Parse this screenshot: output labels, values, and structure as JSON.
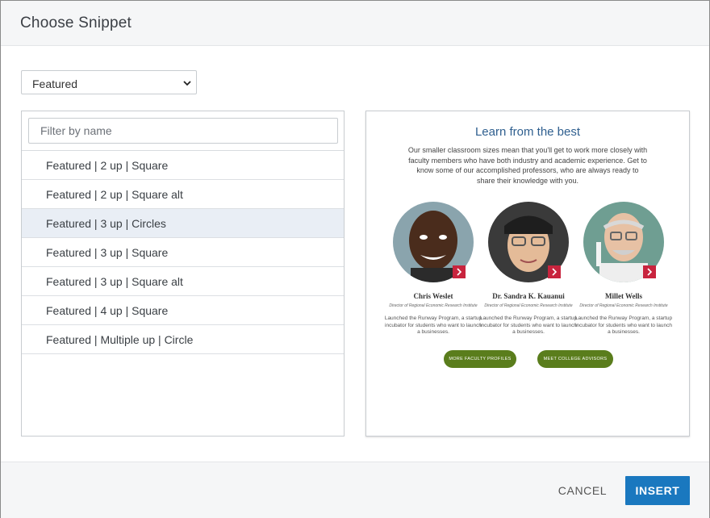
{
  "dialog": {
    "title": "Choose Snippet"
  },
  "category_select": {
    "value": "Featured"
  },
  "filter": {
    "placeholder": "Filter by name",
    "value": ""
  },
  "snippets": [
    {
      "label": "Featured | 2 up | Square",
      "selected": false
    },
    {
      "label": "Featured | 2 up | Square alt",
      "selected": false
    },
    {
      "label": "Featured | 3 up | Circles",
      "selected": true
    },
    {
      "label": "Featured | 3 up | Square",
      "selected": false
    },
    {
      "label": "Featured | 3 up | Square alt",
      "selected": false
    },
    {
      "label": "Featured | 4 up | Square",
      "selected": false
    },
    {
      "label": "Featured | Multiple up | Circle",
      "selected": false
    }
  ],
  "preview": {
    "heading": "Learn from the best",
    "intro": "Our smaller classroom sizes mean that you'll get to work more closely with faculty members who have both industry and academic experience. Get to know some of our accomplished professors, who are always ready to share their knowledge with you.",
    "people": [
      {
        "name": "Chris Weslet",
        "role": "Director of Regional Economic Research Institute",
        "desc": "Launched the Runway Program, a startup incubator for students who want to launch a businesses."
      },
      {
        "name": "Dr. Sandra K. Kauanui",
        "role": "Director of Regional Economic Research Institute",
        "desc": "Launched the Runway Program, a startup incubator for students who want to launch a businesses."
      },
      {
        "name": "Millet Wells",
        "role": "Director of Regional Economic Research Institute",
        "desc": "Launched the Runway Program, a startup incubator for students who want to launch a businesses."
      }
    ],
    "buttons": [
      "MORE FACULTY PROFILES",
      "MEET COLLEGE ADVISORS"
    ]
  },
  "footer": {
    "cancel_label": "CANCEL",
    "insert_label": "INSERT"
  },
  "colors": {
    "primary": "#1a78bf",
    "accent_red": "#c8243e",
    "button_green": "#5a7d1c",
    "heading_blue": "#2f5f8f"
  }
}
